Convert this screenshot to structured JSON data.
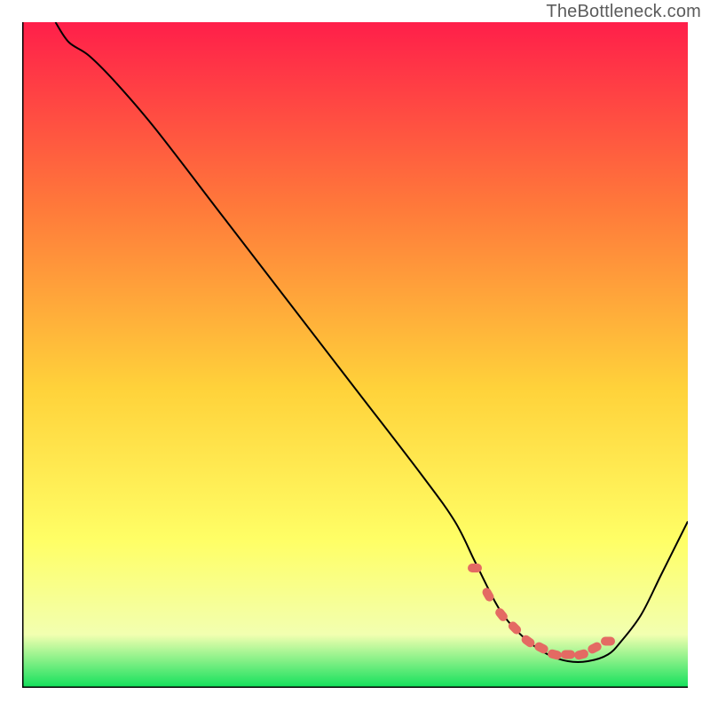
{
  "watermark": "TheBottleneck.com",
  "colors": {
    "grad_top": "#ff1f4a",
    "grad_mid1": "#ff7a3a",
    "grad_mid2": "#ffd23a",
    "grad_mid3": "#ffff66",
    "grad_mid4": "#f2ffb0",
    "grad_bottom": "#11e05b",
    "curve": "#000000",
    "bead": "#e46a63"
  },
  "chart_data": {
    "type": "line",
    "title": "",
    "xlabel": "",
    "ylabel": "",
    "xlim": [
      0,
      100
    ],
    "ylim": [
      0,
      100
    ],
    "series": [
      {
        "name": "bottleneck-curve",
        "x": [
          5,
          7,
          10,
          14,
          20,
          30,
          40,
          50,
          60,
          65,
          68,
          71,
          73,
          76,
          79,
          82,
          85,
          88,
          90,
          93,
          96,
          100
        ],
        "y": [
          100,
          97,
          95,
          91,
          84,
          71,
          58,
          45,
          32,
          25,
          19,
          13,
          10,
          7,
          5,
          4,
          4,
          5,
          7,
          11,
          17,
          25
        ]
      }
    ],
    "markers": {
      "name": "highlight-beads",
      "x": [
        68,
        70,
        72,
        74,
        76,
        78,
        80,
        82,
        84,
        86,
        88
      ],
      "y": [
        18,
        14,
        11,
        9,
        7,
        6,
        5,
        5,
        5,
        6,
        7
      ]
    }
  }
}
